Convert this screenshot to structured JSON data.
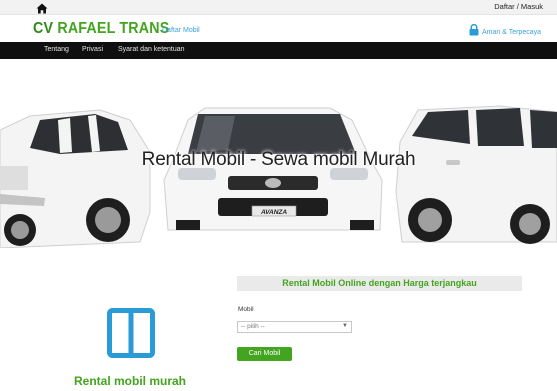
{
  "topbar": {
    "login_label": "Daftar / Masuk"
  },
  "header": {
    "brand_prefix": "CV",
    "brand_name": "RAFAEL TRANS",
    "daftar_label": "Daftar Mobil",
    "secure_label": "Aman & Terpecaya"
  },
  "nav": {
    "items": [
      "Tentang",
      "Privasi",
      "Syarat dan ketentuan"
    ]
  },
  "hero": {
    "caption": "Rental Mobil - Sewa mobil Murah",
    "car_plate": "AVANZA"
  },
  "feature": {
    "title": "Rental mobil murah"
  },
  "search_form": {
    "title": "Rental Mobil Online dengan Harga terjangkau",
    "field_label": "Mobil",
    "select_value": "-- pilih --",
    "button_label": "Cari Mobil"
  },
  "colors": {
    "brand_green": "#43a41f",
    "link_blue": "#3aa3d8",
    "navbar": "#0f0f0f",
    "icon_blue": "#2a9bd7"
  },
  "icons": [
    "home-icon",
    "lock-icon",
    "columns-icon",
    "caret-down-icon"
  ]
}
